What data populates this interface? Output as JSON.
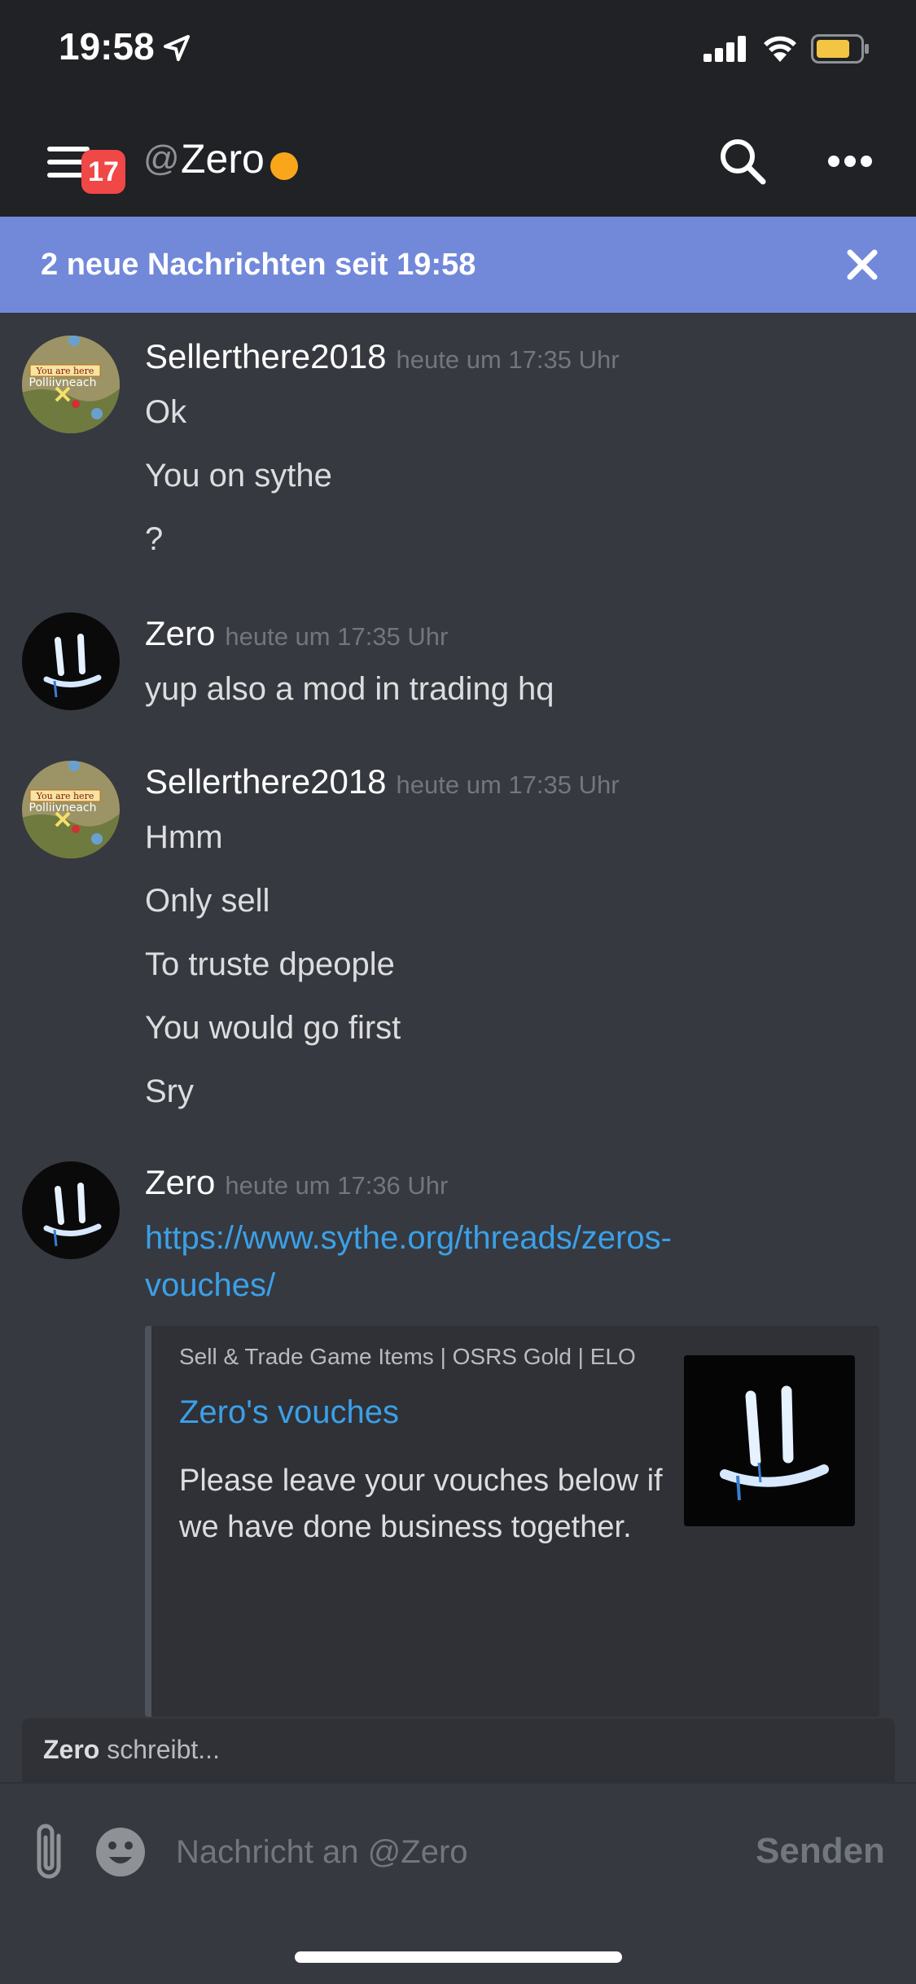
{
  "status_bar": {
    "time": "19:58"
  },
  "header": {
    "badge_count": "17",
    "at_symbol": "@",
    "channel_name": "Zero",
    "status_color": "#faa61a"
  },
  "new_messages": {
    "text": "2 neue Nachrichten seit 19:58"
  },
  "messages": [
    {
      "author": "Sellerthere2018",
      "timestamp": "heute um 17:35 Uhr",
      "lines": [
        "Ok",
        "You on sythe",
        "?"
      ]
    },
    {
      "author": "Zero",
      "timestamp": "heute um 17:35 Uhr",
      "lines": [
        "yup also a mod in trading hq"
      ]
    },
    {
      "author": "Sellerthere2018",
      "timestamp": "heute um 17:35 Uhr",
      "lines": [
        "Hmm",
        "Only sell",
        "To truste dpeople",
        "You would go first",
        "Sry"
      ]
    },
    {
      "author": "Zero",
      "timestamp": "heute um 17:36 Uhr",
      "link_line_1": "https://www.sythe.org/threads/zeros-",
      "link_line_2": "vouches/",
      "embed": {
        "provider": "Sell & Trade Game Items | OSRS Gold | ELO",
        "title": "Zero's vouches",
        "description": "Please leave your vouches below if we have done business together."
      }
    }
  ],
  "avatar_labels": {
    "map_text_1": "You are here",
    "map_text_2": "Polliivneach"
  },
  "typing": {
    "name": "Zero",
    "suffix": " schreibt..."
  },
  "composer": {
    "placeholder": "Nachricht an @Zero",
    "send_label": "Senden"
  }
}
